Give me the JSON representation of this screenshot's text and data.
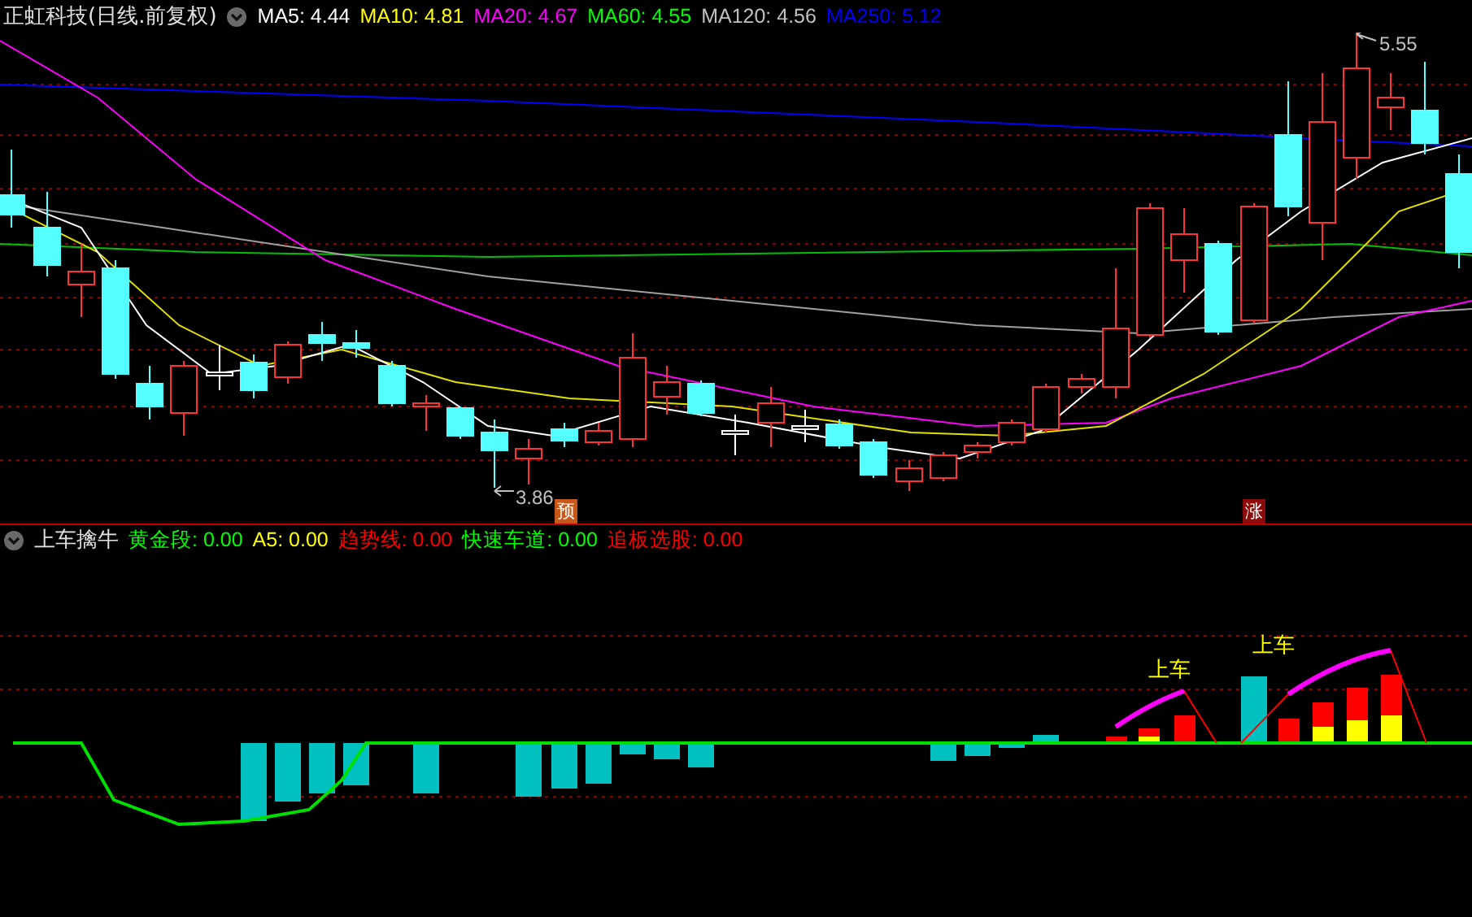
{
  "title": {
    "name": "正虹科技",
    "period": "(日线.前复权)"
  },
  "ma_legend": [
    {
      "label": "MA5: 4.44",
      "color": "#ffffff"
    },
    {
      "label": "MA10: 4.81",
      "color": "#ffff00"
    },
    {
      "label": "MA20: 4.67",
      "color": "#ff00ff"
    },
    {
      "label": "MA60: 4.55",
      "color": "#00ff00"
    },
    {
      "label": "MA120: 4.56",
      "color": "#c0c0c0"
    },
    {
      "label": "MA250: 5.12",
      "color": "#0000ff"
    }
  ],
  "price_labels": {
    "high": "5.55",
    "low": "3.86"
  },
  "markers": [
    {
      "text": "预",
      "color": "#c8581a"
    },
    {
      "text": "涨",
      "color": "#8b0a0a"
    }
  ],
  "indicator": {
    "name": "上车擒牛",
    "values": [
      {
        "label": "黄金段: 0.00",
        "color": "#00ff00"
      },
      {
        "label": "A5: 0.00",
        "color": "#ffff00"
      },
      {
        "label": "趋势线: 0.00",
        "color": "#ff0000"
      },
      {
        "label": "快速车道: 0.00",
        "color": "#00ff00"
      },
      {
        "label": "追板选股: 0.00",
        "color": "#ff0000"
      }
    ]
  },
  "signals": [
    "上车",
    "上车"
  ]
}
